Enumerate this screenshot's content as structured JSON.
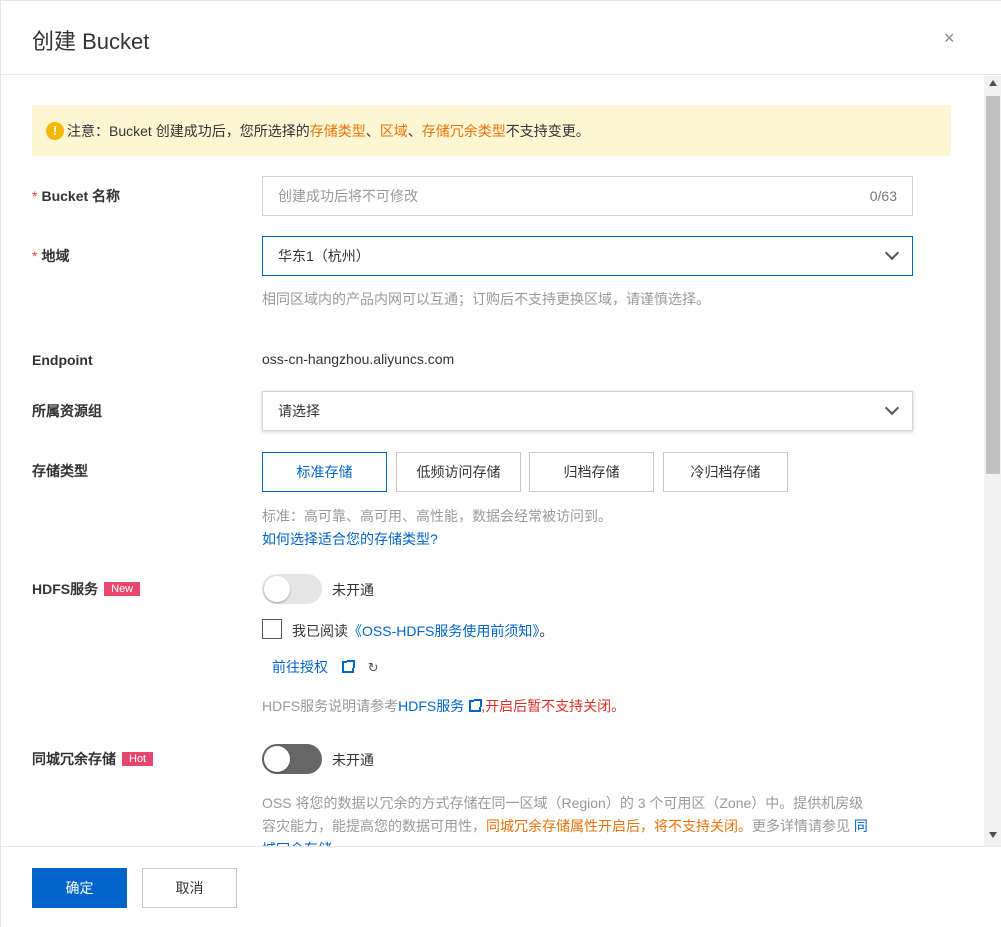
{
  "dialog": {
    "title": "创建 Bucket",
    "close_symbol": "×"
  },
  "notice": {
    "icon": "!",
    "prefix": "注意：Bucket 创建成功后，您所选择的 ",
    "hl1": "存储类型",
    "sep1": "、",
    "hl2": "区域",
    "sep2": "、",
    "hl3": "存储冗余类型",
    "suffix": " 不支持变更。"
  },
  "bucket_name": {
    "required": "*",
    "label": "Bucket 名称",
    "placeholder": "创建成功后将不可修改",
    "counter": "0/63"
  },
  "region": {
    "required": "*",
    "label": "地域",
    "value": "华东1（杭州）",
    "hint": "相同区域内的产品内网可以互通；订购后不支持更换区域，请谨慎选择。"
  },
  "endpoint": {
    "label": "Endpoint",
    "value": "oss-cn-hangzhou.aliyuncs.com"
  },
  "resource_group": {
    "label": "所属资源组",
    "value": "请选择"
  },
  "storage_class": {
    "label": "存储类型",
    "options": [
      "标准存储",
      "低频访问存储",
      "归档存储",
      "冷归档存储"
    ],
    "selected_index": 0,
    "hint": "标准：高可靠、高可用、高性能，数据会经常被访问到。",
    "help_link": "如何选择适合您的存储类型?"
  },
  "hdfs": {
    "label": "HDFS服务",
    "badge": "New",
    "switch_text": "未开通",
    "checkbox_prefix": "我已阅读",
    "checkbox_link": "《OSS-HDFS服务使用前须知》",
    "checkbox_suffix": "。",
    "auth_link": "前往授权",
    "note_prefix": "HDFS服务说明请参考",
    "note_link": "HDFS服务",
    "note_warn": ",开启后暂不支持关闭。"
  },
  "zrs": {
    "label": "同城冗余存储",
    "badge": "Hot",
    "switch_text": "未开通",
    "desc_line1": "OSS 将您的数据以冗余的方式存储在同一区域（Region）的 3 个可用区（Zone）中。提供机房级",
    "desc_line2_prefix": "容灾能力，能提高您的数据可用性，",
    "desc_line2_warn": "同城冗余存储属性开启后，将不支持关闭。",
    "desc_line2_suffix": "更多详情请参见 ",
    "desc_link_part1": "同",
    "desc_link_part2": "城冗余存储"
  },
  "footer": {
    "confirm": "确定",
    "cancel": "取消"
  },
  "colors": {
    "primary": "#0064c8",
    "warning": "#e8730b",
    "danger": "#d93026",
    "notice_bg": "#fdf6d3",
    "badge": "#e6466e"
  }
}
